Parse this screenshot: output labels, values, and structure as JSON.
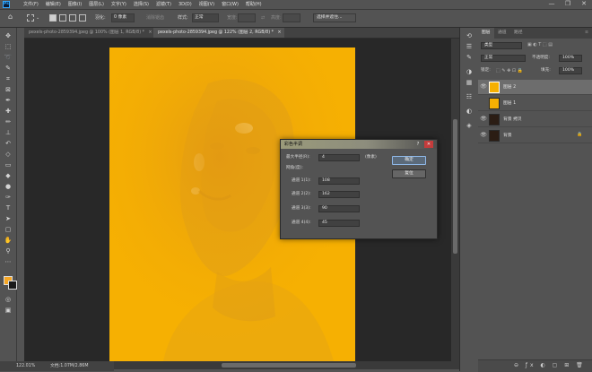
{
  "menubar": {
    "items": [
      "文件(F)",
      "编辑(E)",
      "图像(I)",
      "图层(L)",
      "文字(Y)",
      "选择(S)",
      "滤镜(T)",
      "3D(D)",
      "视图(V)",
      "窗口(W)",
      "帮助(H)"
    ],
    "window_controls": [
      "—",
      "❐",
      "✕"
    ]
  },
  "options_bar": {
    "feather_label": "羽化:",
    "feather_value": "0 像素",
    "antialias_label": "消除锯齿",
    "style_label": "样式:",
    "style_value": "正常",
    "width_label": "宽度:",
    "height_label": "高度:",
    "select_mask_button": "选择并遮住..."
  },
  "tabs": [
    {
      "label": "pexels-photo-2859394.jpeg @ 100% (图层 1, RGB/8) *",
      "close": "×"
    },
    {
      "label": "pexels-photo-2859394.jpeg @ 122% (图层 2, RGB/8) *",
      "close": "×"
    }
  ],
  "status_bar": {
    "zoom": "122.01%",
    "doc_info": "文档:1.07M/2.86M"
  },
  "panel": {
    "tabs": [
      "图层",
      "通道",
      "路径"
    ],
    "kind_label": "类型",
    "blend_mode": "正常",
    "opacity_label": "不透明度:",
    "opacity_value": "100%",
    "lock_label": "锁定:",
    "fill_label": "填充:",
    "fill_value": "100%",
    "layers": [
      {
        "name": "图层 2",
        "selected": true,
        "thumb_color": "#f6b002"
      },
      {
        "name": "图层 1",
        "selected": false,
        "thumb_color": "#f6b002"
      },
      {
        "name": "背景 拷贝",
        "selected": false,
        "thumb_color": "#2b1d14"
      },
      {
        "name": "背景",
        "selected": false,
        "thumb_color": "#2b1d14"
      }
    ]
  },
  "dialog": {
    "title": "彩色半调",
    "max_radius_label": "最大半径(R):",
    "max_radius_value": "4",
    "unit": "(像素)",
    "angles_label": "网角(度):",
    "channels": [
      {
        "label": "通道 1(1):",
        "value": "108"
      },
      {
        "label": "通道 2(2):",
        "value": "162"
      },
      {
        "label": "通道 3(3):",
        "value": "90"
      },
      {
        "label": "通道 4(4):",
        "value": "45"
      }
    ],
    "ok_label": "确定",
    "reset_label": "复位",
    "help": "?",
    "close": "✕"
  },
  "colors": {
    "foreground": "#f6a623",
    "background": "#1a1a1a",
    "canvas_fill": "#f6b002"
  }
}
